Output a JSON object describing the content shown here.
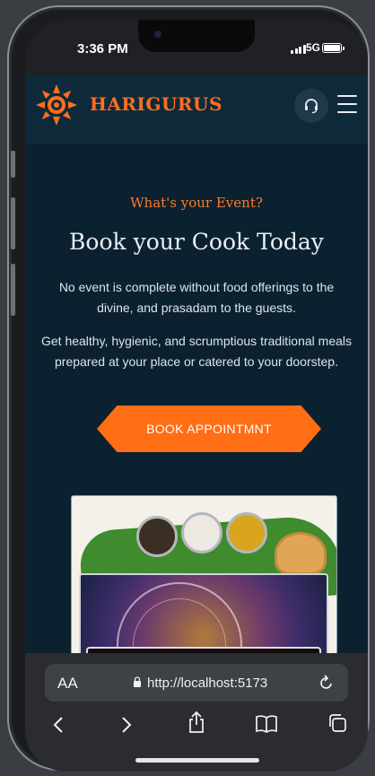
{
  "status": {
    "time": "3:36 PM",
    "network": "5G"
  },
  "header": {
    "brand": "HARIGURUS",
    "logo_icon": "sun-emblem-icon",
    "support_icon": "headset-icon",
    "menu_icon": "hamburger-menu-icon",
    "brand_color": "#ff6f1e"
  },
  "hero": {
    "eyebrow": "What's your Event?",
    "title": "Book your Cook Today",
    "paragraph1": "No event is complete without food offerings to the divine, and prasadam to the guests.",
    "paragraph2": "Get healthy, hygienic, and scrumptious traditional meals prepared at your place or catered to your doorstep.",
    "cta_label": "BOOK APPOINTMNT",
    "accent": "#ff6d14"
  },
  "browser": {
    "aa_label": "AA",
    "url": "http://localhost:5173",
    "lock_icon": "lock-icon",
    "reload_icon": "reload-icon",
    "nav_icons": [
      "back-icon",
      "forward-icon",
      "share-icon",
      "bookmarks-icon",
      "tabs-icon"
    ]
  }
}
